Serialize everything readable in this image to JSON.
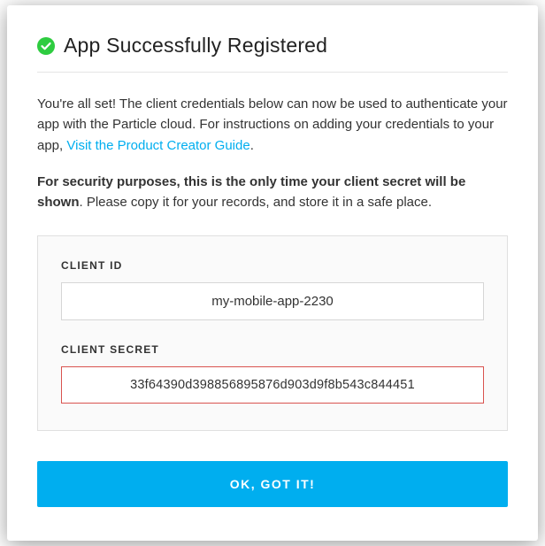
{
  "modal": {
    "title": "App Successfully Registered",
    "intro": {
      "line": "You're all set! The client credentials below can now be used to authenticate your app with the Particle cloud. For instructions on adding your credentials to your app, ",
      "link_text": "Visit the Product Creator Guide",
      "period": "."
    },
    "security": {
      "bold": "For security purposes, this is the only time your client secret will be shown",
      "rest": ". Please copy it for your records, and store it in a safe place."
    },
    "client_id_label": "CLIENT ID",
    "client_id_value": "my-mobile-app-2230",
    "client_secret_label": "CLIENT SECRET",
    "client_secret_value": "33f64390d398856895876d903d9f8b543c844451",
    "confirm_label": "OK, GOT IT!"
  },
  "colors": {
    "accent": "#00aeef",
    "success": "#2ecc40",
    "danger_border": "#d9534f"
  }
}
